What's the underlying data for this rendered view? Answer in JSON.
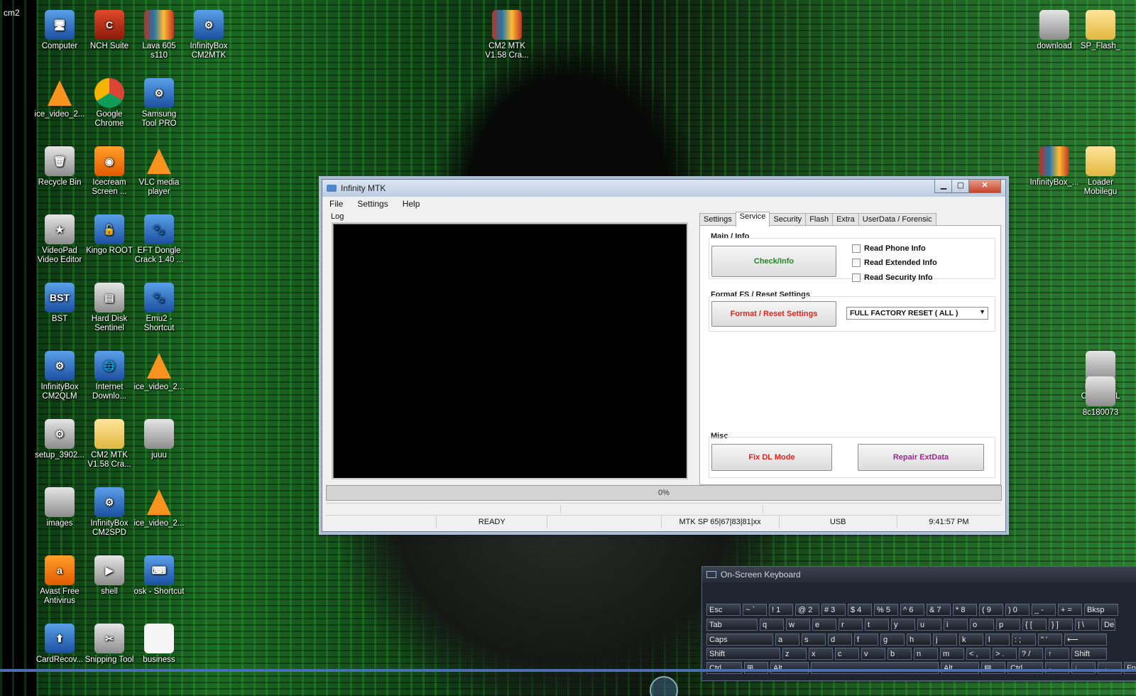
{
  "desktop": {
    "corner_label": "cm2",
    "icons": [
      {
        "label": "Computer",
        "icon": "computer-icon",
        "glyph": "🖥"
      },
      {
        "label": "NCH Suite",
        "icon": "nch-suite-icon",
        "glyph": "C"
      },
      {
        "label": "Lava 605 s110",
        "icon": "winrar-archive-icon",
        "glyph": ""
      },
      {
        "label": "InfinityBox CM2MTK",
        "icon": "infinitybox-icon",
        "glyph": "⚙"
      },
      {
        "label": "CM2 MTK V1.58 Cra...",
        "icon": "winrar-archive-icon",
        "glyph": ""
      },
      {
        "label": "download",
        "icon": "image-file-icon",
        "glyph": ""
      },
      {
        "label": "SP_Flash_",
        "icon": "folder-icon",
        "glyph": ""
      },
      {
        "label": "ice_video_2...",
        "icon": "vlc-cone-icon",
        "glyph": ""
      },
      {
        "label": "Google Chrome",
        "icon": "chrome-icon",
        "glyph": ""
      },
      {
        "label": "Samsung Tool PRO",
        "icon": "samsung-tool-icon",
        "glyph": "⚙"
      },
      {
        "label": "Recycle Bin",
        "icon": "recycle-bin-icon",
        "glyph": "🗑"
      },
      {
        "label": "Icecream Screen ...",
        "icon": "icecream-icon",
        "glyph": "◉"
      },
      {
        "label": "VLC media player",
        "icon": "vlc-cone-icon",
        "glyph": ""
      },
      {
        "label": "InfinityBox_...",
        "icon": "winrar-archive-icon",
        "glyph": ""
      },
      {
        "label": "Loader Mobilegu",
        "icon": "folder-icon",
        "glyph": ""
      },
      {
        "label": "VideoPad Video Editor",
        "icon": "videopad-icon",
        "glyph": "★"
      },
      {
        "label": "Kingo ROOT",
        "icon": "kingo-root-icon",
        "glyph": "🔓"
      },
      {
        "label": "EFT Dongle Crack 1.40 ...",
        "icon": "eft-dongle-icon",
        "glyph": "🐾"
      },
      {
        "label": "BST",
        "icon": "bst-icon",
        "glyph": "BST"
      },
      {
        "label": "Hard Disk Sentinel",
        "icon": "hard-disk-sentinel-icon",
        "glyph": "▤"
      },
      {
        "label": "Emu2 - Shortcut",
        "icon": "emu2-icon",
        "glyph": "🐾"
      },
      {
        "label": "InfinityBox CM2QLM",
        "icon": "infinitybox-icon",
        "glyph": "⚙"
      },
      {
        "label": "Internet Downlo...",
        "icon": "idm-icon",
        "glyph": "🌐"
      },
      {
        "label": "ice_video_2...",
        "icon": "vlc-cone-icon",
        "glyph": ""
      },
      {
        "label": "PLEASE CHANNEL",
        "icon": "image-file-icon",
        "glyph": ""
      },
      {
        "label": "8c180073",
        "icon": "image-file-icon",
        "glyph": ""
      },
      {
        "label": "setup_3902...",
        "icon": "setup-icon",
        "glyph": "⚙"
      },
      {
        "label": "CM2 MTK V1.58 Cra...",
        "icon": "folder-icon",
        "glyph": ""
      },
      {
        "label": "juuu",
        "icon": "image-file-icon",
        "glyph": ""
      },
      {
        "label": "images",
        "icon": "image-file-icon",
        "glyph": ""
      },
      {
        "label": "InfinityBox CM2SPD",
        "icon": "infinitybox-icon",
        "glyph": "⚙"
      },
      {
        "label": "ice_video_2...",
        "icon": "vlc-cone-icon",
        "glyph": ""
      },
      {
        "label": "Avast Free Antivirus",
        "icon": "avast-icon",
        "glyph": "a"
      },
      {
        "label": "shell",
        "icon": "shell-icon",
        "glyph": "▶"
      },
      {
        "label": "osk - Shortcut",
        "icon": "osk-icon",
        "glyph": "⌨"
      },
      {
        "label": "CardRecov...",
        "icon": "cardrecovery-icon",
        "glyph": "⬆"
      },
      {
        "label": "Snipping Tool",
        "icon": "snipping-tool-icon",
        "glyph": "✂"
      },
      {
        "label": "business",
        "icon": "document-icon",
        "glyph": ""
      }
    ]
  },
  "window": {
    "title": "Infinity MTK",
    "menu": [
      "File",
      "Settings",
      "Help"
    ],
    "log_label": "Log",
    "tabs": [
      "Settings",
      "Service",
      "Security",
      "Flash",
      "Extra",
      "UserData / Forensic"
    ],
    "active_tab": "Service",
    "main_info": {
      "label": "Main / Info",
      "button": "Check/Info",
      "button_color": "#1f8a1f",
      "checkboxes": [
        "Read Phone Info",
        "Read Extended Info",
        "Read Security Info"
      ]
    },
    "format": {
      "label": "Format FS / Reset Settings",
      "button": "Format / Reset Settings",
      "button_color": "#e0261c",
      "select_value": "FULL FACTORY RESET ( ALL )"
    },
    "misc": {
      "label": "Misc",
      "fix_button": "Fix DL Mode",
      "fix_color": "#e0261c",
      "repair_button": "Repair ExtData",
      "repair_color": "#9a2a8a"
    },
    "progress": {
      "text": "0%",
      "value": 0
    },
    "status": {
      "state": "READY",
      "platform": "MTK SP 65|67|83|81|xx",
      "connection": "USB",
      "time": "9:41:57 PM"
    }
  },
  "keyboard": {
    "title": "On-Screen Keyboard",
    "rows": [
      [
        "Esc",
        "~ `",
        "! 1",
        "@ 2",
        "# 3",
        "$ 4",
        "% 5",
        "^ 6",
        "& 7",
        "* 8",
        "( 9",
        ") 0",
        "_ -",
        "+ =",
        "Bksp"
      ],
      [
        "Tab",
        "q",
        "w",
        "e",
        "r",
        "t",
        "y",
        "u",
        "i",
        "o",
        "p",
        "{ [",
        "} ]",
        "| \\",
        "De"
      ],
      [
        "Caps",
        "a",
        "s",
        "d",
        "f",
        "g",
        "h",
        "j",
        "k",
        "l",
        ": ;",
        "\" '",
        "⟵"
      ],
      [
        "Shift",
        "z",
        "x",
        "c",
        "v",
        "b",
        "n",
        "m",
        "< ,",
        "> .",
        "? /",
        "↑",
        "Shift"
      ],
      [
        "Ctrl",
        "⊞",
        "Alt",
        "",
        "Alt",
        "▤",
        "Ctrl",
        "←",
        "↓",
        "→",
        "Fn"
      ]
    ]
  }
}
